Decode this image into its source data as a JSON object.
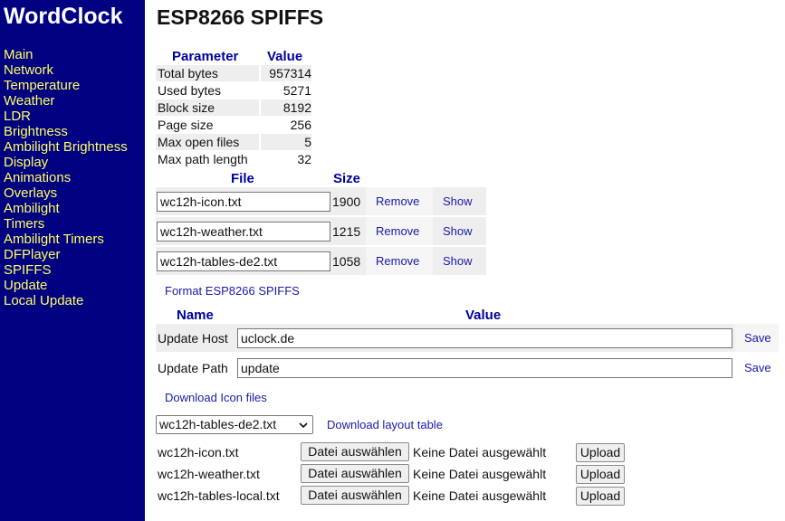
{
  "sidebar": {
    "brand": "WordClock",
    "items": [
      "Main",
      "Network",
      "Temperature",
      "Weather",
      "LDR",
      "Brightness",
      "Ambilight Brightness",
      "Display",
      "Animations",
      "Overlays",
      "Ambilight",
      "Timers",
      "Ambilight Timers",
      "DFPlayer",
      "SPIFFS",
      "Update",
      "Local Update"
    ]
  },
  "page_title": "ESP8266 SPIFFS",
  "params": {
    "header_param": "Parameter",
    "header_value": "Value",
    "rows": [
      {
        "name": "Total bytes",
        "value": "957314"
      },
      {
        "name": "Used bytes",
        "value": "5271"
      },
      {
        "name": "Block size",
        "value": "8192"
      },
      {
        "name": "Page size",
        "value": "256"
      },
      {
        "name": "Max open files",
        "value": "5"
      },
      {
        "name": "Max path length",
        "value": "32"
      }
    ]
  },
  "files": {
    "header_file": "File",
    "header_size": "Size",
    "remove_label": "Remove",
    "show_label": "Show",
    "rows": [
      {
        "name": "wc12h-icon.txt",
        "size": "1900"
      },
      {
        "name": "wc12h-weather.txt",
        "size": "1215"
      },
      {
        "name": "wc12h-tables-de2.txt",
        "size": "1058"
      }
    ],
    "format_link": "Format ESP8266 SPIFFS"
  },
  "settings": {
    "header_name": "Name",
    "header_value": "Value",
    "save_label": "Save",
    "rows": [
      {
        "label": "Update Host",
        "value": "uclock.de"
      },
      {
        "label": "Update Path",
        "value": "update"
      }
    ],
    "download_icons_link": "Download Icon files"
  },
  "layout_table": {
    "selected": "wc12h-tables-de2.txt",
    "download_link": "Download layout table"
  },
  "uploads": {
    "choose_label": "Datei auswählen",
    "no_file_label": "Keine Datei ausgewählt",
    "upload_label": "Upload",
    "rows": [
      {
        "name": "wc12h-icon.txt"
      },
      {
        "name": "wc12h-weather.txt"
      },
      {
        "name": "wc12h-tables-local.txt"
      }
    ]
  }
}
